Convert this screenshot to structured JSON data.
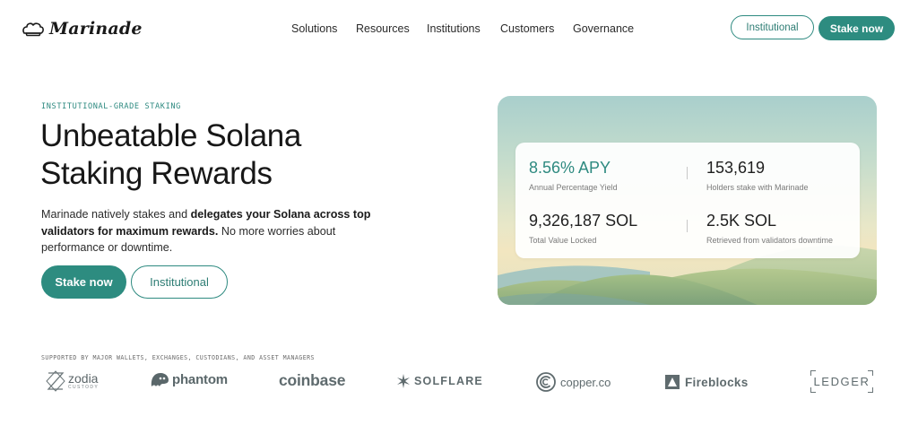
{
  "header": {
    "brand": "Marinade",
    "nav": [
      "Solutions",
      "Resources",
      "Institutions",
      "Customers",
      "Governance"
    ],
    "institutional_label": "Institutional",
    "stake_label": "Stake now"
  },
  "hero": {
    "eyebrow": "INSTITUTIONAL-GRADE STAKING",
    "title_line1": "Unbeatable Solana",
    "title_line2": "Staking Rewards",
    "desc_part1": "Marinade natively stakes and ",
    "desc_bold": "delegates your Solana across top validators for maximum rewards.",
    "desc_part2": " No more worries about performance or downtime.",
    "stake_label": "Stake now",
    "institutional_label": "Institutional"
  },
  "stats": [
    {
      "value": "8.56% APY",
      "label": "Annual Percentage Yield"
    },
    {
      "value": "153,619",
      "label": "Holders stake with Marinade"
    },
    {
      "value": "9,326,187 SOL",
      "label": "Total Value Locked"
    },
    {
      "value": "2.5K SOL",
      "label": "Retrieved from validators downtime"
    }
  ],
  "partners": {
    "title": "SUPPORTED BY MAJOR WALLETS, EXCHANGES, CUSTODIANS, AND ASSET MANAGERS",
    "zodia": "zodia",
    "zodia_sub": "CUSTODY",
    "phantom": "phantom",
    "coinbase": "coinbase",
    "solflare": "SOLFLARE",
    "copper": "copper.co",
    "fireblocks": "Fireblocks",
    "ledger": "LEDGER"
  },
  "colors": {
    "accent": "#2d8c80",
    "text": "#171717"
  },
  "icons": {
    "brand": "chef-hat-icon",
    "phantom": "ghost-icon",
    "solflare": "sunburst-icon",
    "fireblocks": "triangle-box-icon"
  }
}
